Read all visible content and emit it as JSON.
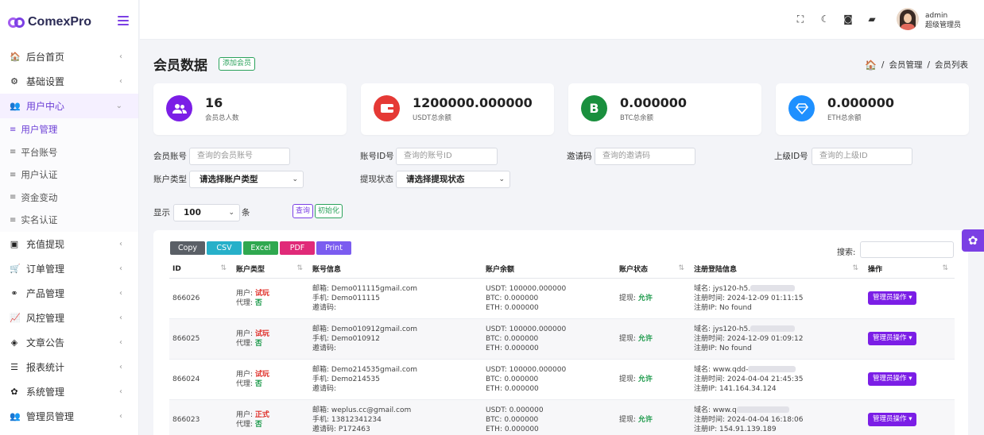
{
  "app": {
    "name": "ComexPro"
  },
  "sidebar": {
    "items": [
      {
        "label": "后台首页",
        "icon": "home-icon",
        "glyph": "🏠"
      },
      {
        "label": "基础设置",
        "icon": "settings-icon",
        "glyph": "⚙"
      },
      {
        "label": "用户中心",
        "icon": "users-icon",
        "glyph": "👥"
      }
    ],
    "subitems": [
      {
        "label": "用户管理"
      },
      {
        "label": "平台账号"
      },
      {
        "label": "用户认证"
      },
      {
        "label": "资金变动"
      },
      {
        "label": "实名认证"
      }
    ],
    "items2": [
      {
        "label": "充值提现",
        "icon": "wallet-icon",
        "glyph": "▣"
      },
      {
        "label": "订单管理",
        "icon": "cart-icon",
        "glyph": "🛒"
      },
      {
        "label": "产品管理",
        "icon": "product-icon",
        "glyph": "⚭"
      },
      {
        "label": "风控管理",
        "icon": "chart-icon",
        "glyph": "📈"
      },
      {
        "label": "文章公告",
        "icon": "layers-icon",
        "glyph": "◈"
      },
      {
        "label": "报表统计",
        "icon": "report-icon",
        "glyph": "☰"
      },
      {
        "label": "系统管理",
        "icon": "gear-icon",
        "glyph": "✿"
      },
      {
        "label": "管理员管理",
        "icon": "admin-icon",
        "glyph": "👥"
      }
    ]
  },
  "topbar": {
    "user_name": "admin",
    "user_role": "超级管理员"
  },
  "page": {
    "title": "会员数据",
    "add_button": "添加会员",
    "breadcrumb": [
      "会员管理",
      "会员列表"
    ],
    "breadcrumb_sep": "/"
  },
  "stats": [
    {
      "value": "16",
      "label": "会员总人数",
      "color": "#7b1ee6",
      "icon": "users-icon"
    },
    {
      "value": "1200000.000000",
      "label": "USDT总余额",
      "color": "#e53935",
      "icon": "wallet-icon"
    },
    {
      "value": "0.000000",
      "label": "BTC总余额",
      "color": "#1a8f3e",
      "icon": "btc-icon",
      "glyph": "B"
    },
    {
      "value": "0.000000",
      "label": "ETH总余额",
      "color": "#1e90ff",
      "icon": "diamond-icon"
    }
  ],
  "filters": {
    "account_label": "会员账号",
    "account_placeholder": "查询的会员账号",
    "id_label": "账号ID号",
    "id_placeholder": "查询的账号ID",
    "invite_label": "邀请码",
    "invite_placeholder": "查询的邀请码",
    "parent_label": "上级ID号",
    "parent_placeholder": "查询的上级ID",
    "type_label": "账户类型",
    "type_value": "请选择账户类型",
    "withdraw_label": "提现状态",
    "withdraw_value": "请选择提现状态",
    "show_label": "显示",
    "show_value": "100",
    "show_suffix": "条",
    "query_button": "查询",
    "reset_button": "初始化"
  },
  "export_buttons": [
    {
      "label": "Copy",
      "color": "#5a5f66"
    },
    {
      "label": "CSV",
      "color": "#27b0c9"
    },
    {
      "label": "Excel",
      "color": "#2fa84f"
    },
    {
      "label": "PDF",
      "color": "#e02a78"
    },
    {
      "label": "Print",
      "color": "#7b5cf0"
    }
  ],
  "search_label": "搜索:",
  "table": {
    "headers": [
      "ID",
      "账户类型",
      "账号信息",
      "账户余额",
      "账户状态",
      "注册登陆信息",
      "操作"
    ],
    "rows": [
      {
        "id": "866026",
        "type_user_label": "用户:",
        "type_user": "试玩",
        "type_agent_label": "代理:",
        "type_agent": "否",
        "email": "邮箱: Demo011115gmail.com",
        "phone": "手机: Demo011115",
        "invite": "邀请码:",
        "usdt": "USDT: 100000.000000",
        "btc": "BTC: 0.000000",
        "eth": "ETH: 0.000000",
        "withdraw_label": "提现:",
        "withdraw": "允许",
        "domain": "域名: jys120-h5.",
        "reg_time": "注册时间: 2024-12-09 01:11:15",
        "reg_ip": "注册IP: No found",
        "op": "管理员操作"
      },
      {
        "id": "866025",
        "type_user_label": "用户:",
        "type_user": "试玩",
        "type_agent_label": "代理:",
        "type_agent": "否",
        "email": "邮箱: Demo010912gmail.com",
        "phone": "手机: Demo010912",
        "invite": "邀请码:",
        "usdt": "USDT: 100000.000000",
        "btc": "BTC: 0.000000",
        "eth": "ETH: 0.000000",
        "withdraw_label": "提现:",
        "withdraw": "允许",
        "domain": "域名: jys120-h5.",
        "reg_time": "注册时间: 2024-12-09 01:09:12",
        "reg_ip": "注册IP: No found",
        "op": "管理员操作"
      },
      {
        "id": "866024",
        "type_user_label": "用户:",
        "type_user": "试玩",
        "type_agent_label": "代理:",
        "type_agent": "否",
        "email": "邮箱: Demo214535gmail.com",
        "phone": "手机: Demo214535",
        "invite": "邀请码:",
        "usdt": "USDT: 100000.000000",
        "btc": "BTC: 0.000000",
        "eth": "ETH: 0.000000",
        "withdraw_label": "提现:",
        "withdraw": "允许",
        "domain": "域名: www.qdd-",
        "reg_time": "注册时间: 2024-04-04 21:45:35",
        "reg_ip": "注册IP: 141.164.34.124",
        "op": "管理员操作"
      },
      {
        "id": "866023",
        "type_user_label": "用户:",
        "type_user": "正式",
        "type_agent_label": "代理:",
        "type_agent": "否",
        "email": "邮箱: weplus.cc@gmail.com",
        "phone": "手机: 13812341234",
        "invite": "邀请码: P172463",
        "usdt": "USDT: 0.000000",
        "btc": "BTC: 0.000000",
        "eth": "ETH: 0.000000",
        "withdraw_label": "提现:",
        "withdraw": "允许",
        "domain": "域名: www.q",
        "reg_time": "注册时间: 2024-04-04 16:18:06",
        "reg_ip": "注册IP: 154.91.139.189",
        "op": "管理员操作"
      }
    ]
  }
}
